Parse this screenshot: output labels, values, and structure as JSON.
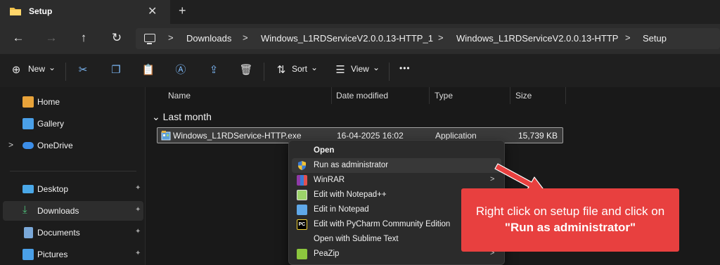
{
  "window": {
    "tab_title": "Setup",
    "close_glyph": "✕",
    "new_tab_glyph": "+"
  },
  "nav": {
    "back_glyph": "←",
    "forward_glyph": "→",
    "up_glyph": "↑",
    "refresh_glyph": "↻"
  },
  "breadcrumb": {
    "items": [
      "Downloads",
      "Windows_L1RDServiceV2.0.0.13-HTTP_1",
      "Windows_L1RDServiceV2.0.0.13-HTTP",
      "Setup"
    ],
    "separator": ">"
  },
  "toolbar": {
    "new_label": "New",
    "sort_label": "Sort",
    "view_label": "View",
    "more_glyph": "•••",
    "dropdown_glyph": "⌄"
  },
  "sidebar": {
    "items": [
      {
        "label": "Home",
        "icon": "home-icon",
        "color": "#e8a33a"
      },
      {
        "label": "Gallery",
        "icon": "gallery-icon",
        "color": "#4aa0e8"
      },
      {
        "label": "OneDrive",
        "icon": "onedrive-icon",
        "color": "#3c8ee8"
      },
      {
        "label": "Desktop",
        "icon": "desktop-icon",
        "color": "#4aa8e8"
      },
      {
        "label": "Downloads",
        "icon": "downloads-icon",
        "color": "#4ec07a"
      },
      {
        "label": "Documents",
        "icon": "documents-icon",
        "color": "#7aa8d8"
      },
      {
        "label": "Pictures",
        "icon": "pictures-icon",
        "color": "#4aa0e8"
      }
    ],
    "pin_glyph": "📌",
    "expand_glyph": ">"
  },
  "columns": {
    "name": "Name",
    "date": "Date modified",
    "type": "Type",
    "size": "Size"
  },
  "group_label": "Last month",
  "group_glyph": "⌄",
  "file": {
    "name": "Windows_L1RDService-HTTP.exe",
    "date": "16-04-2025 16:02",
    "type": "Application",
    "size": "15,739 KB"
  },
  "context_menu": {
    "items": [
      {
        "label": "Open",
        "icon": "none"
      },
      {
        "label": "Run as administrator",
        "icon": "uac-shield-icon"
      },
      {
        "label": "WinRAR",
        "icon": "winrar-icon"
      },
      {
        "label": "Edit with Notepad++",
        "icon": "notepadpp-icon"
      },
      {
        "label": "Edit in Notepad",
        "icon": "notepad-icon"
      },
      {
        "label": "Edit with PyCharm Community Edition",
        "icon": "pycharm-icon"
      },
      {
        "label": "Open with Sublime Text",
        "icon": "none"
      },
      {
        "label": "PeaZip",
        "icon": "peazip-icon"
      }
    ],
    "submenu_glyph": ">"
  },
  "annotation": {
    "line1": "Right click on setup file and click on",
    "line2": "\"Run as administrator\"",
    "color": "#e8403f"
  }
}
